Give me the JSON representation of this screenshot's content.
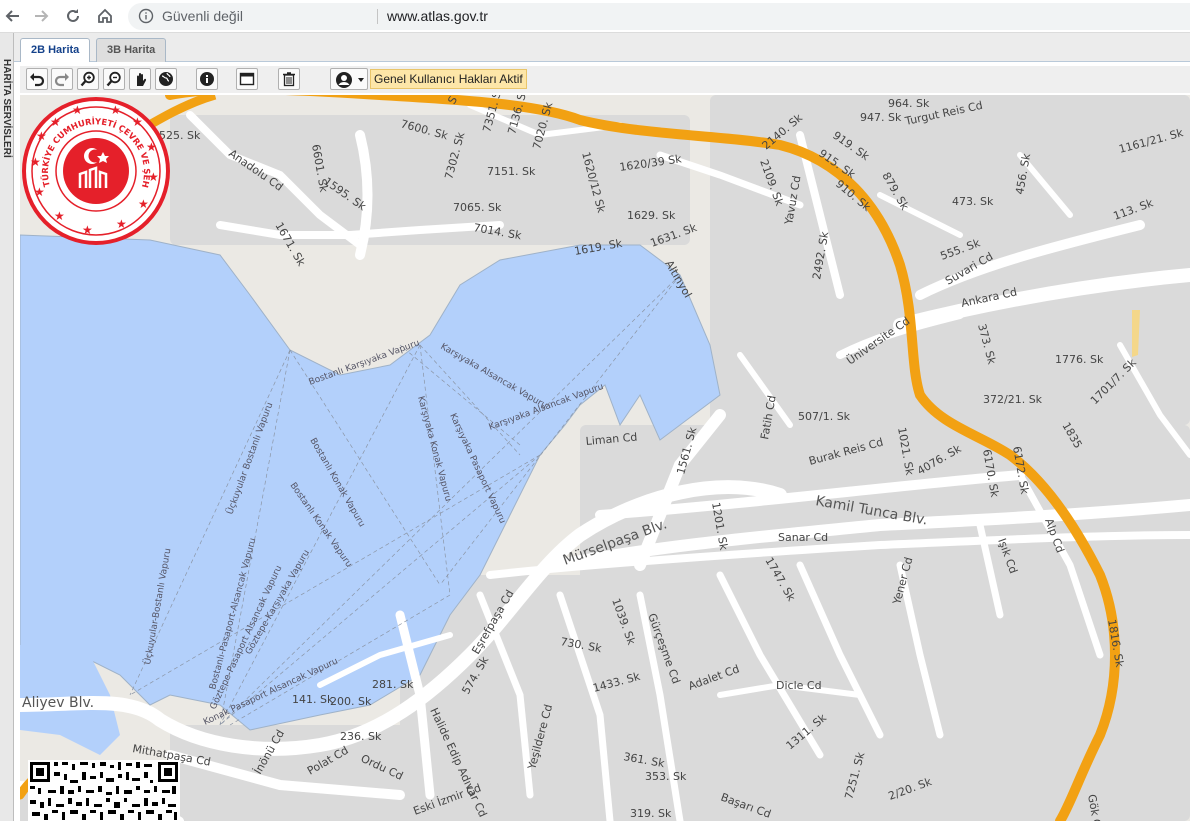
{
  "browser": {
    "security_text": "Güvenli değil",
    "url": "www.atlas.gov.tr"
  },
  "side_panel": {
    "label": "HARİTA SERVİSLERİ"
  },
  "tabs": [
    {
      "label": "2B Harita",
      "active": true
    },
    {
      "label": "3B Harita",
      "active": false
    }
  ],
  "toolbar": {
    "icons": [
      "undo-icon",
      "redo-icon",
      "zoom-in-icon",
      "zoom-out-icon",
      "pan-hand-icon",
      "globe-icon",
      "info-icon",
      "window-icon",
      "trash-icon",
      "user-icon"
    ],
    "status_label": "Genel Kullanıcı Hakları Aktif"
  },
  "seal": {
    "text": "TÜRKİYE CUMHURİYETİ ÇEVRE VE ŞEHİRCİLİK BAKANLIĞI"
  },
  "colors": {
    "water": "#b3d0fb",
    "land": "#ebe9e4",
    "urban": "#dcdcdc",
    "road": "#ffffff",
    "highway": "#f2a113",
    "seal_red": "#e5202a"
  },
  "map": {
    "labels": [
      "Anadolu Cd",
      "6525. Sk",
      "6601. Sk",
      "7600. Sk",
      "7351. Sk",
      "7136. Sk",
      "7020. Sk",
      "1620/12 Sk",
      "1620/39 Sk",
      "7302. Sk",
      "7151. Sk",
      "1595. Sk",
      "7065. Sk",
      "7014. Sk",
      "1629. Sk",
      "1671. Sk",
      "1619. Sk",
      "1631. Sk",
      "2140. Sk",
      "2109. Sk",
      "Yavuz Cd",
      "964. Sk",
      "947. Sk",
      "Turgut Reis Cd",
      "919. Sk",
      "915. Sk",
      "879. Sk",
      "910. Sk",
      "473. Sk",
      "456. Sk",
      "1161/21. Sk",
      "113. Sk",
      "555. Sk",
      "Suvari Cd",
      "Ankara Cd",
      "Altınyol",
      "2492. Sk",
      "373. Sk",
      "1776. Sk",
      "Üniversite Cd",
      "Fatih Cd",
      "507/1. Sk",
      "1701/7. Sk",
      "372/21. Sk",
      "Burak Reis Cd",
      "1021. Sk",
      "4076. Sk",
      "6170. Sk",
      "6172. Sk",
      "Liman Cd",
      "1561. Sk",
      "Kamil Tunca Blv.",
      "Sanar Cd",
      "1201. Sk",
      "Alp Cd",
      "Işık Cd",
      "Yener Cd",
      "1747. Sk",
      "Mürselpaşa Blv.",
      "Eşrefpaşa Cd",
      "1039. Sk",
      "Gürçeşme Cd",
      "730. Sk",
      "1433. Sk",
      "Adalet Cd",
      "Dicle Cd",
      "281. Sk",
      "200. Sk",
      "141. Sk",
      "574. Sk",
      "Halide Edip Adıvar Cd",
      "Yeşildere Cd",
      "236. Sk",
      "Mithatpaşa Cd",
      "İnönü Cd",
      "Polat Cd",
      "Ordu Cd",
      "Eski İzmir Cd",
      "361. Sk",
      "353. Sk",
      "319. Sk",
      "Başarı Cd",
      "1311. Sk",
      "7251. Sk",
      "2/20. Sk",
      "1816. Sk",
      "Gök Cd",
      "Aliyev Blv.",
      "Bostanlı Karşıyaka Vapuru",
      "Karşıyaka Alsancak Vapuru",
      "Karşıyaka Konak Vapuru",
      "Karşıyaka Pasaport Vapuru",
      "Bostanlı Konak Vapuru",
      "Üçkuyular Bostanlı Vapuru",
      "Üçkuyular-Bostanlı Vapuru",
      "Bostanlı-Pasaport-Alsancak Vapuru",
      "Göztepe-Karşıyaka Vapuru",
      "Göztepe-Pasaport Alsancak Vapuru",
      "Konak Pasaport Alsancak Vapuru",
      "Bostanlı Konak Vapuru",
      "Karşıyaka Alsancak Vapuru",
      "1835",
      "S"
    ]
  }
}
